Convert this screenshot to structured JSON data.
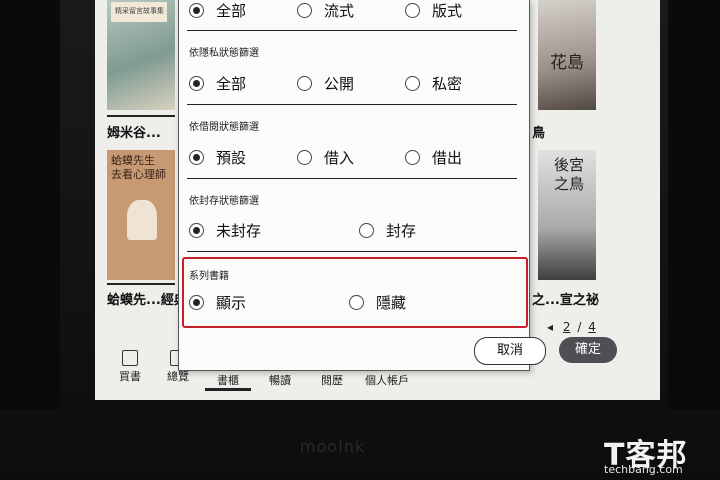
{
  "library": {
    "cover_a_strip": "精采留言故事集",
    "cover_b_title_line1": "蛤蟆先生",
    "cover_b_title_line2": "去看心理師",
    "cover_c_title": "花島",
    "cover_d_title_line1": "後宮",
    "cover_d_title_line2": "之鳥",
    "book_titles": [
      "姆米谷...",
      "蛤蟆先...經典",
      "鳥",
      "之...宣之祕"
    ],
    "pager": {
      "current": "2",
      "separator": "/",
      "total": "4"
    },
    "nav": [
      {
        "label": "買書"
      },
      {
        "label": "總覽"
      },
      {
        "label": "書櫃"
      },
      {
        "label": "暢讀"
      },
      {
        "label": "閱歷"
      },
      {
        "label": "個人帳戶"
      }
    ],
    "device_brand": "mooInk"
  },
  "filter_dialog": {
    "format": {
      "options": [
        {
          "label": "全部",
          "selected": true
        },
        {
          "label": "流式",
          "selected": false
        },
        {
          "label": "版式",
          "selected": false
        }
      ]
    },
    "privacy": {
      "title": "依隱私狀態篩選",
      "options": [
        {
          "label": "全部",
          "selected": true
        },
        {
          "label": "公開",
          "selected": false
        },
        {
          "label": "私密",
          "selected": false
        }
      ]
    },
    "lending": {
      "title": "依借閱狀態篩選",
      "options": [
        {
          "label": "預設",
          "selected": true
        },
        {
          "label": "借入",
          "selected": false
        },
        {
          "label": "借出",
          "selected": false
        }
      ]
    },
    "archive": {
      "title": "依封存狀態篩選",
      "options": [
        {
          "label": "未封存",
          "selected": true
        },
        {
          "label": "封存",
          "selected": false
        }
      ]
    },
    "series": {
      "title": "系列書籍",
      "options": [
        {
          "label": "顯示",
          "selected": true
        },
        {
          "label": "隱藏",
          "selected": false
        }
      ]
    },
    "cancel_label": "取消",
    "ok_label": "確定",
    "highlight_color": "#c8202a"
  },
  "watermark": {
    "main": "T客邦",
    "sub": "techbang.com"
  }
}
